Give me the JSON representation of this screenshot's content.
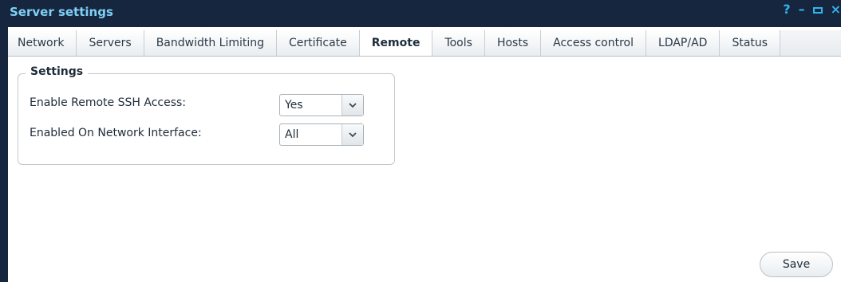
{
  "window": {
    "title": "Server settings",
    "controls": {
      "help": "?",
      "minimize": "–",
      "close": "×"
    }
  },
  "tabs": [
    {
      "label": "Network",
      "active": false
    },
    {
      "label": "Servers",
      "active": false
    },
    {
      "label": "Bandwidth Limiting",
      "active": false
    },
    {
      "label": "Certificate",
      "active": false
    },
    {
      "label": "Remote",
      "active": true
    },
    {
      "label": "Tools",
      "active": false
    },
    {
      "label": "Hosts",
      "active": false
    },
    {
      "label": "Access control",
      "active": false
    },
    {
      "label": "LDAP/AD",
      "active": false
    },
    {
      "label": "Status",
      "active": false
    }
  ],
  "settings": {
    "legend": "Settings",
    "ssh": {
      "label": "Enable Remote SSH Access:",
      "value": "Yes"
    },
    "interface": {
      "label": "Enabled On Network Interface:",
      "value": "All"
    }
  },
  "footer": {
    "save_label": "Save"
  },
  "colors": {
    "titlebar": "#16263f",
    "title_text": "#7fd0f5",
    "controls": "#33b3ec"
  }
}
